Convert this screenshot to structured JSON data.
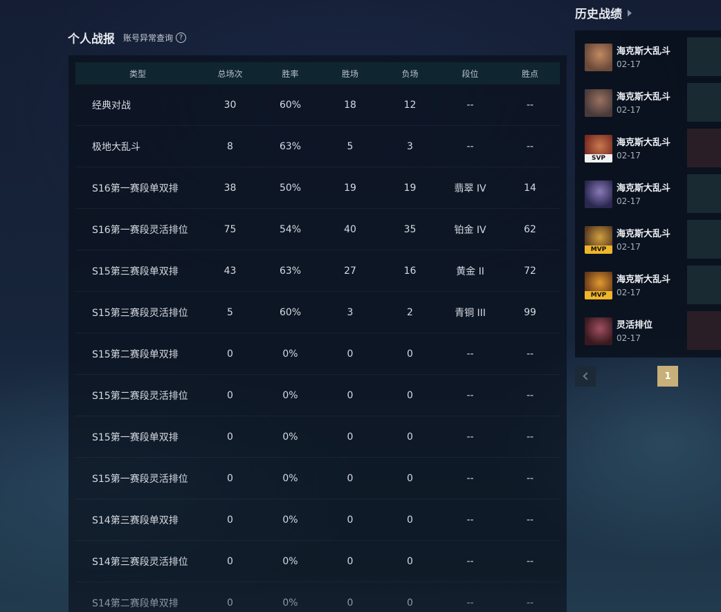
{
  "personal_stats": {
    "title": "个人战报",
    "anomaly_query_label": "账号异常查询",
    "help_icon_glyph": "?",
    "columns": [
      "类型",
      "总场次",
      "胜率",
      "胜场",
      "负场",
      "段位",
      "胜点"
    ],
    "rows": [
      [
        "经典对战",
        "30",
        "60%",
        "18",
        "12",
        "--",
        "--"
      ],
      [
        "极地大乱斗",
        "8",
        "63%",
        "5",
        "3",
        "--",
        "--"
      ],
      [
        "S16第一赛段单双排",
        "38",
        "50%",
        "19",
        "19",
        "翡翠 IV",
        "14"
      ],
      [
        "S16第一赛段灵活排位",
        "75",
        "54%",
        "40",
        "35",
        "铂金 IV",
        "62"
      ],
      [
        "S15第三赛段单双排",
        "43",
        "63%",
        "27",
        "16",
        "黄金 II",
        "72"
      ],
      [
        "S15第三赛段灵活排位",
        "5",
        "60%",
        "3",
        "2",
        "青铜 III",
        "99"
      ],
      [
        "S15第二赛段单双排",
        "0",
        "0%",
        "0",
        "0",
        "--",
        "--"
      ],
      [
        "S15第二赛段灵活排位",
        "0",
        "0%",
        "0",
        "0",
        "--",
        "--"
      ],
      [
        "S15第一赛段单双排",
        "0",
        "0%",
        "0",
        "0",
        "--",
        "--"
      ],
      [
        "S15第一赛段灵活排位",
        "0",
        "0%",
        "0",
        "0",
        "--",
        "--"
      ],
      [
        "S14第三赛段单双排",
        "0",
        "0%",
        "0",
        "0",
        "--",
        "--"
      ],
      [
        "S14第三赛段灵活排位",
        "0",
        "0%",
        "0",
        "0",
        "--",
        "--"
      ],
      [
        "S14第二赛段单双排",
        "0",
        "0%",
        "0",
        "0",
        "--",
        "--"
      ]
    ]
  },
  "history": {
    "title": "历史战绩",
    "matches": [
      {
        "mode": "海克斯大乱斗",
        "date": "02-17",
        "badge": "",
        "result": "win",
        "avatar_colors": [
          "#6b4a3a",
          "#c28a62"
        ]
      },
      {
        "mode": "海克斯大乱斗",
        "date": "02-17",
        "badge": "",
        "result": "win",
        "avatar_colors": [
          "#4a3a3a",
          "#9a7260"
        ]
      },
      {
        "mode": "海克斯大乱斗",
        "date": "02-17",
        "badge": "SVP",
        "result": "loss",
        "avatar_colors": [
          "#7a2a22",
          "#c97a4e"
        ]
      },
      {
        "mode": "海克斯大乱斗",
        "date": "02-17",
        "badge": "",
        "result": "win",
        "avatar_colors": [
          "#2a2850",
          "#8a7ab8"
        ]
      },
      {
        "mode": "海克斯大乱斗",
        "date": "02-17",
        "badge": "MVP",
        "result": "win",
        "avatar_colors": [
          "#5a3a20",
          "#d0a040"
        ]
      },
      {
        "mode": "海克斯大乱斗",
        "date": "02-17",
        "badge": "MVP",
        "result": "win",
        "avatar_colors": [
          "#6a3a1a",
          "#e09a30"
        ]
      },
      {
        "mode": "灵活排位",
        "date": "02-17",
        "badge": "",
        "result": "loss",
        "avatar_colors": [
          "#3a1a20",
          "#a05060"
        ]
      }
    ]
  },
  "pagination": {
    "current_page": "1"
  }
}
